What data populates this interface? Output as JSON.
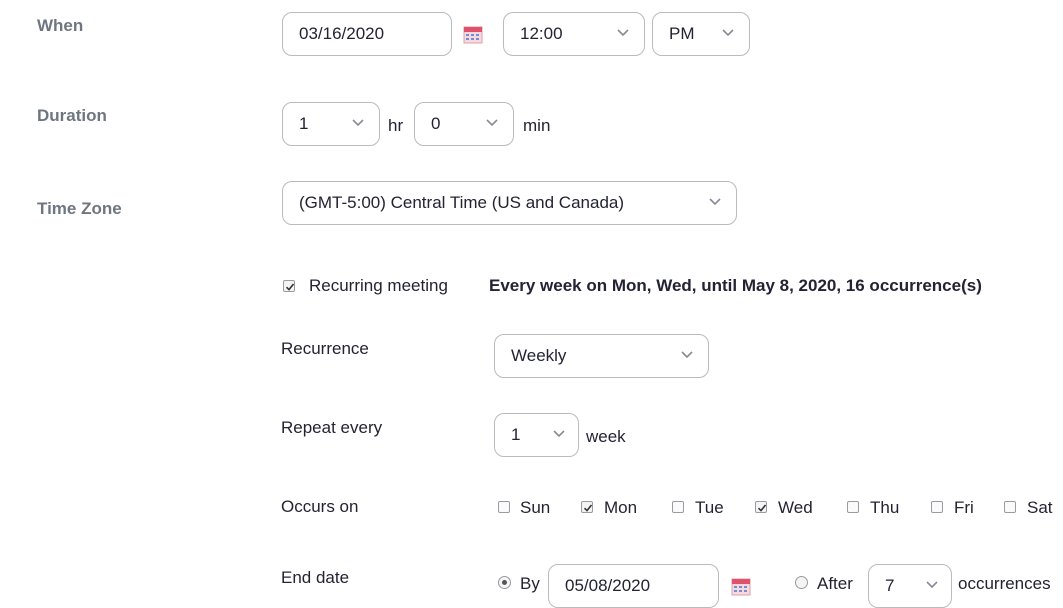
{
  "when": {
    "label": "When",
    "date": "03/16/2020",
    "time": "12:00",
    "ampm": "PM"
  },
  "duration": {
    "label": "Duration",
    "hours": "1",
    "hr_unit": "hr",
    "minutes": "0",
    "min_unit": "min"
  },
  "timezone": {
    "label": "Time Zone",
    "value": "(GMT-5:00) Central Time (US and Canada)"
  },
  "recurring": {
    "label": "Recurring meeting",
    "checked": true,
    "summary": "Every week on Mon, Wed, until May 8, 2020, 16 occurrence(s)"
  },
  "recurrence": {
    "label": "Recurrence",
    "value": "Weekly"
  },
  "repeat_every": {
    "label": "Repeat every",
    "value": "1",
    "unit": "week"
  },
  "occurs_on": {
    "label": "Occurs on",
    "days": [
      {
        "label": "Sun",
        "checked": false
      },
      {
        "label": "Mon",
        "checked": true
      },
      {
        "label": "Tue",
        "checked": false
      },
      {
        "label": "Wed",
        "checked": true
      },
      {
        "label": "Thu",
        "checked": false
      },
      {
        "label": "Fri",
        "checked": false
      },
      {
        "label": "Sat",
        "checked": false
      }
    ]
  },
  "end_date": {
    "label": "End date",
    "by_label": "By",
    "by_selected": true,
    "by_date": "05/08/2020",
    "after_label": "After",
    "after_value": "7",
    "after_unit": "occurrences"
  },
  "icons": {
    "calendar": "calendar-icon",
    "chevron": "chevron-down-icon",
    "check": "checkmark-icon"
  },
  "colors": {
    "label_gray": "#6e7680",
    "border": "#babac0",
    "text": "#232333",
    "calendar_red": "#e0516b"
  }
}
